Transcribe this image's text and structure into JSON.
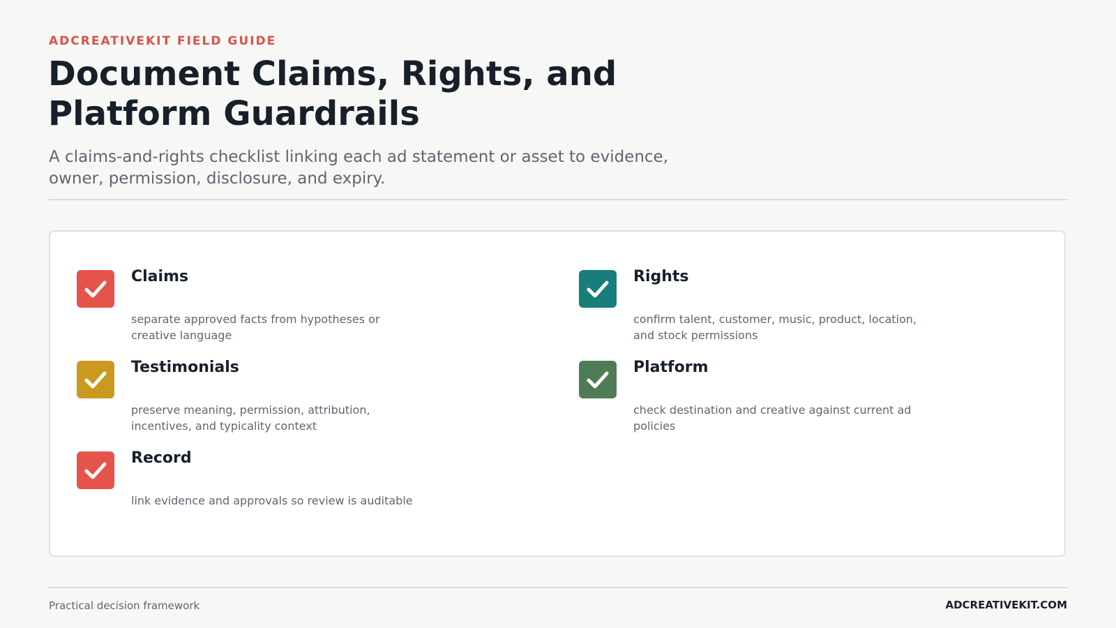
{
  "header": {
    "eyebrow": "ADCREATIVEKIT FIELD GUIDE",
    "title": "Document Claims, Rights, and Platform Guardrails",
    "subtitle": "A claims-and-rights checklist linking each ad statement or asset to evidence, owner, permission, disclosure, and expiry."
  },
  "checklist": [
    {
      "title": "Claims",
      "description": "separate approved facts from hypotheses or creative language",
      "icon": "checkbox-checked-icon",
      "color": "#e5544a"
    },
    {
      "title": "Rights",
      "description": "confirm talent, customer, music, product, location, and stock permissions",
      "icon": "checkbox-checked-icon",
      "color": "#177e7a"
    },
    {
      "title": "Testimonials",
      "description": "preserve meaning, permission, attribution, incentives, and typicality context",
      "icon": "checkbox-checked-icon",
      "color": "#c99a1e"
    },
    {
      "title": "Platform",
      "description": "check destination and creative against current ad policies",
      "icon": "checkbox-checked-icon",
      "color": "#4f7c57"
    },
    {
      "title": "Record",
      "description": "link evidence and approvals so review is auditable",
      "icon": "checkbox-checked-icon",
      "color": "#e5544a"
    }
  ],
  "footer": {
    "left": "Practical decision framework",
    "right": "ADCREATIVEKIT.COM"
  }
}
